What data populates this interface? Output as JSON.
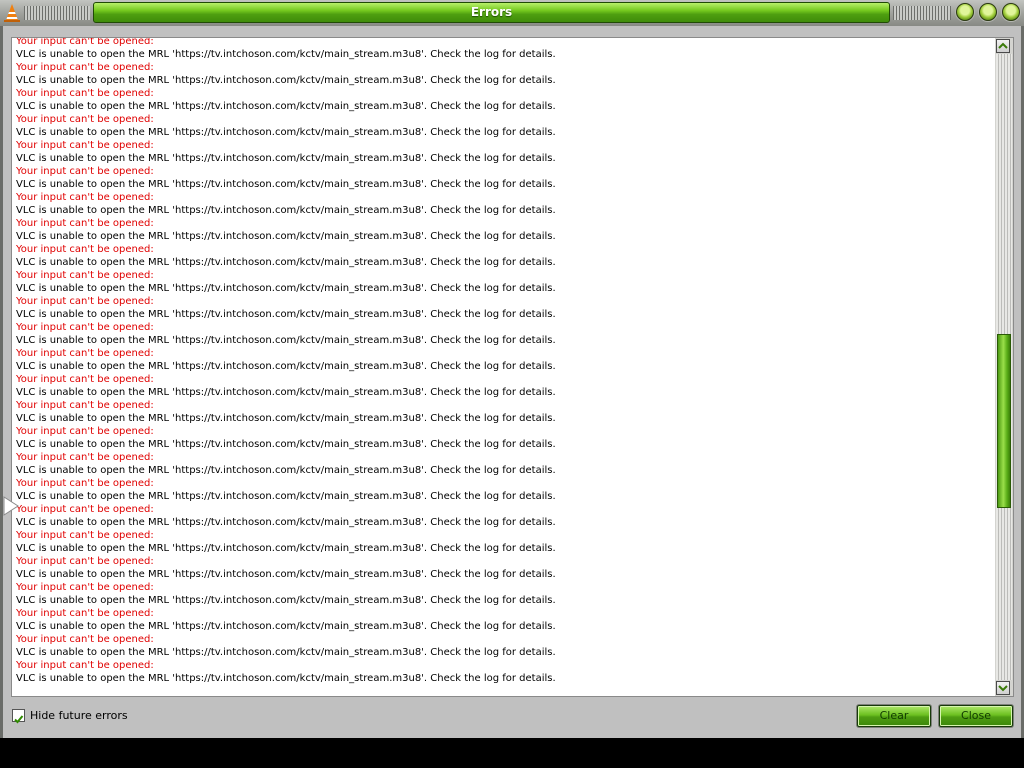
{
  "window": {
    "title": "Errors"
  },
  "log": {
    "entries": [
      {
        "error": "Your input can't be opened:",
        "message": "VLC is unable to open the MRL 'https://tv.intchoson.com/kctv/main_stream.m3u8'. Check the log for details."
      },
      {
        "error": "Your input can't be opened:",
        "message": "VLC is unable to open the MRL 'https://tv.intchoson.com/kctv/main_stream.m3u8'. Check the log for details."
      },
      {
        "error": "Your input can't be opened:",
        "message": "VLC is unable to open the MRL 'https://tv.intchoson.com/kctv/main_stream.m3u8'. Check the log for details."
      },
      {
        "error": "Your input can't be opened:",
        "message": "VLC is unable to open the MRL 'https://tv.intchoson.com/kctv/main_stream.m3u8'. Check the log for details."
      },
      {
        "error": "Your input can't be opened:",
        "message": "VLC is unable to open the MRL 'https://tv.intchoson.com/kctv/main_stream.m3u8'. Check the log for details."
      },
      {
        "error": "Your input can't be opened:",
        "message": "VLC is unable to open the MRL 'https://tv.intchoson.com/kctv/main_stream.m3u8'. Check the log for details."
      },
      {
        "error": "Your input can't be opened:",
        "message": "VLC is unable to open the MRL 'https://tv.intchoson.com/kctv/main_stream.m3u8'. Check the log for details."
      },
      {
        "error": "Your input can't be opened:",
        "message": "VLC is unable to open the MRL 'https://tv.intchoson.com/kctv/main_stream.m3u8'. Check the log for details."
      },
      {
        "error": "Your input can't be opened:",
        "message": "VLC is unable to open the MRL 'https://tv.intchoson.com/kctv/main_stream.m3u8'. Check the log for details."
      },
      {
        "error": "Your input can't be opened:",
        "message": "VLC is unable to open the MRL 'https://tv.intchoson.com/kctv/main_stream.m3u8'. Check the log for details."
      },
      {
        "error": "Your input can't be opened:",
        "message": "VLC is unable to open the MRL 'https://tv.intchoson.com/kctv/main_stream.m3u8'. Check the log for details."
      },
      {
        "error": "Your input can't be opened:",
        "message": "VLC is unable to open the MRL 'https://tv.intchoson.com/kctv/main_stream.m3u8'. Check the log for details."
      },
      {
        "error": "Your input can't be opened:",
        "message": "VLC is unable to open the MRL 'https://tv.intchoson.com/kctv/main_stream.m3u8'. Check the log for details."
      },
      {
        "error": "Your input can't be opened:",
        "message": "VLC is unable to open the MRL 'https://tv.intchoson.com/kctv/main_stream.m3u8'. Check the log for details."
      },
      {
        "error": "Your input can't be opened:",
        "message": "VLC is unable to open the MRL 'https://tv.intchoson.com/kctv/main_stream.m3u8'. Check the log for details."
      },
      {
        "error": "Your input can't be opened:",
        "message": "VLC is unable to open the MRL 'https://tv.intchoson.com/kctv/main_stream.m3u8'. Check the log for details."
      },
      {
        "error": "Your input can't be opened:",
        "message": "VLC is unable to open the MRL 'https://tv.intchoson.com/kctv/main_stream.m3u8'. Check the log for details."
      },
      {
        "error": "Your input can't be opened:",
        "message": "VLC is unable to open the MRL 'https://tv.intchoson.com/kctv/main_stream.m3u8'. Check the log for details."
      },
      {
        "error": "Your input can't be opened:",
        "message": "VLC is unable to open the MRL 'https://tv.intchoson.com/kctv/main_stream.m3u8'. Check the log for details."
      },
      {
        "error": "Your input can't be opened:",
        "message": "VLC is unable to open the MRL 'https://tv.intchoson.com/kctv/main_stream.m3u8'. Check the log for details."
      },
      {
        "error": "Your input can't be opened:",
        "message": "VLC is unable to open the MRL 'https://tv.intchoson.com/kctv/main_stream.m3u8'. Check the log for details."
      },
      {
        "error": "Your input can't be opened:",
        "message": "VLC is unable to open the MRL 'https://tv.intchoson.com/kctv/main_stream.m3u8'. Check the log for details."
      },
      {
        "error": "Your input can't be opened:",
        "message": "VLC is unable to open the MRL 'https://tv.intchoson.com/kctv/main_stream.m3u8'. Check the log for details."
      },
      {
        "error": "Your input can't be opened:",
        "message": "VLC is unable to open the MRL 'https://tv.intchoson.com/kctv/main_stream.m3u8'. Check the log for details."
      },
      {
        "error": "Your input can't be opened:",
        "message": "VLC is unable to open the MRL 'https://tv.intchoson.com/kctv/main_stream.m3u8'. Check the log for details."
      }
    ]
  },
  "scroll": {
    "position_fraction": 0.62
  },
  "footer": {
    "hide_checkbox_checked": true,
    "hide_label": "Hide future errors",
    "clear_label": "Clear",
    "close_label": "Close"
  },
  "colors": {
    "error_text": "#e00000",
    "message_text": "#000000",
    "accent_green": "#6cc020"
  },
  "icons": [
    "vlc-cone-icon",
    "minimize-icon",
    "maximize-icon",
    "close-icon",
    "scroll-up-icon",
    "scroll-down-icon",
    "checkmark-icon",
    "pointer-cursor-icon"
  ]
}
